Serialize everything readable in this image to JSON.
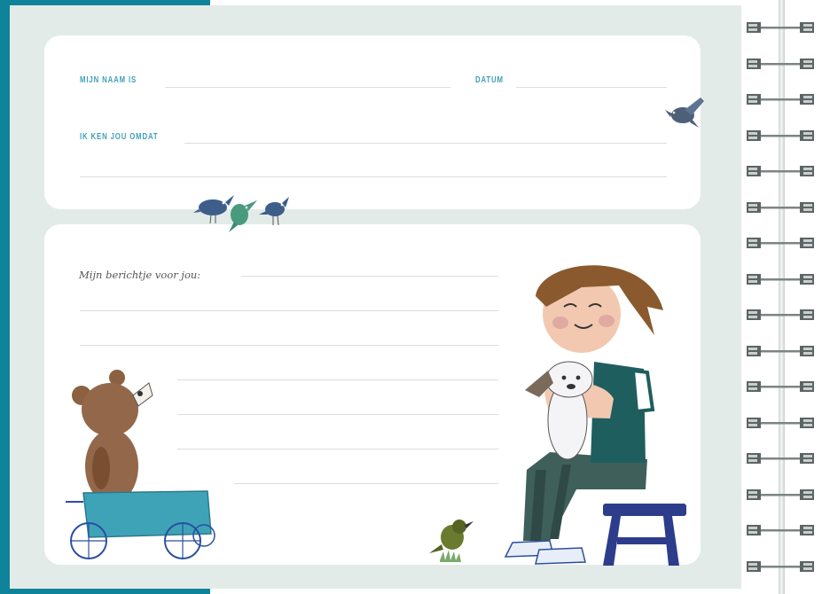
{
  "form": {
    "name_label": "MIJN NAAM IS",
    "date_label": "DATUM",
    "reason_label": "IK KEN JOU OMDAT"
  },
  "message": {
    "label": "Mijn berichtje voor jou:"
  },
  "illustrations": [
    "birds-on-card",
    "bird-flying",
    "teddy-bear-in-wagon",
    "small-bird-on-grass",
    "boy-hugging-dog-on-stool"
  ],
  "colors": {
    "accent": "#0e8399",
    "label_blue": "#3f9fb9",
    "page_background": "#e3ebe9",
    "card": "#ffffff"
  }
}
